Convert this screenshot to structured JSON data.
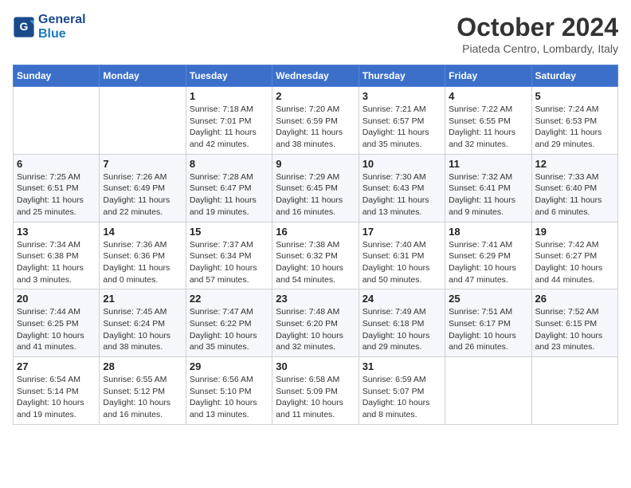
{
  "header": {
    "logo_line1": "General",
    "logo_line2": "Blue",
    "month_title": "October 2024",
    "subtitle": "Piateda Centro, Lombardy, Italy"
  },
  "days_of_week": [
    "Sunday",
    "Monday",
    "Tuesday",
    "Wednesday",
    "Thursday",
    "Friday",
    "Saturday"
  ],
  "weeks": [
    [
      {
        "day": "",
        "info": ""
      },
      {
        "day": "",
        "info": ""
      },
      {
        "day": "1",
        "info": "Sunrise: 7:18 AM\nSunset: 7:01 PM\nDaylight: 11 hours and 42 minutes."
      },
      {
        "day": "2",
        "info": "Sunrise: 7:20 AM\nSunset: 6:59 PM\nDaylight: 11 hours and 38 minutes."
      },
      {
        "day": "3",
        "info": "Sunrise: 7:21 AM\nSunset: 6:57 PM\nDaylight: 11 hours and 35 minutes."
      },
      {
        "day": "4",
        "info": "Sunrise: 7:22 AM\nSunset: 6:55 PM\nDaylight: 11 hours and 32 minutes."
      },
      {
        "day": "5",
        "info": "Sunrise: 7:24 AM\nSunset: 6:53 PM\nDaylight: 11 hours and 29 minutes."
      }
    ],
    [
      {
        "day": "6",
        "info": "Sunrise: 7:25 AM\nSunset: 6:51 PM\nDaylight: 11 hours and 25 minutes."
      },
      {
        "day": "7",
        "info": "Sunrise: 7:26 AM\nSunset: 6:49 PM\nDaylight: 11 hours and 22 minutes."
      },
      {
        "day": "8",
        "info": "Sunrise: 7:28 AM\nSunset: 6:47 PM\nDaylight: 11 hours and 19 minutes."
      },
      {
        "day": "9",
        "info": "Sunrise: 7:29 AM\nSunset: 6:45 PM\nDaylight: 11 hours and 16 minutes."
      },
      {
        "day": "10",
        "info": "Sunrise: 7:30 AM\nSunset: 6:43 PM\nDaylight: 11 hours and 13 minutes."
      },
      {
        "day": "11",
        "info": "Sunrise: 7:32 AM\nSunset: 6:41 PM\nDaylight: 11 hours and 9 minutes."
      },
      {
        "day": "12",
        "info": "Sunrise: 7:33 AM\nSunset: 6:40 PM\nDaylight: 11 hours and 6 minutes."
      }
    ],
    [
      {
        "day": "13",
        "info": "Sunrise: 7:34 AM\nSunset: 6:38 PM\nDaylight: 11 hours and 3 minutes."
      },
      {
        "day": "14",
        "info": "Sunrise: 7:36 AM\nSunset: 6:36 PM\nDaylight: 11 hours and 0 minutes."
      },
      {
        "day": "15",
        "info": "Sunrise: 7:37 AM\nSunset: 6:34 PM\nDaylight: 10 hours and 57 minutes."
      },
      {
        "day": "16",
        "info": "Sunrise: 7:38 AM\nSunset: 6:32 PM\nDaylight: 10 hours and 54 minutes."
      },
      {
        "day": "17",
        "info": "Sunrise: 7:40 AM\nSunset: 6:31 PM\nDaylight: 10 hours and 50 minutes."
      },
      {
        "day": "18",
        "info": "Sunrise: 7:41 AM\nSunset: 6:29 PM\nDaylight: 10 hours and 47 minutes."
      },
      {
        "day": "19",
        "info": "Sunrise: 7:42 AM\nSunset: 6:27 PM\nDaylight: 10 hours and 44 minutes."
      }
    ],
    [
      {
        "day": "20",
        "info": "Sunrise: 7:44 AM\nSunset: 6:25 PM\nDaylight: 10 hours and 41 minutes."
      },
      {
        "day": "21",
        "info": "Sunrise: 7:45 AM\nSunset: 6:24 PM\nDaylight: 10 hours and 38 minutes."
      },
      {
        "day": "22",
        "info": "Sunrise: 7:47 AM\nSunset: 6:22 PM\nDaylight: 10 hours and 35 minutes."
      },
      {
        "day": "23",
        "info": "Sunrise: 7:48 AM\nSunset: 6:20 PM\nDaylight: 10 hours and 32 minutes."
      },
      {
        "day": "24",
        "info": "Sunrise: 7:49 AM\nSunset: 6:18 PM\nDaylight: 10 hours and 29 minutes."
      },
      {
        "day": "25",
        "info": "Sunrise: 7:51 AM\nSunset: 6:17 PM\nDaylight: 10 hours and 26 minutes."
      },
      {
        "day": "26",
        "info": "Sunrise: 7:52 AM\nSunset: 6:15 PM\nDaylight: 10 hours and 23 minutes."
      }
    ],
    [
      {
        "day": "27",
        "info": "Sunrise: 6:54 AM\nSunset: 5:14 PM\nDaylight: 10 hours and 19 minutes."
      },
      {
        "day": "28",
        "info": "Sunrise: 6:55 AM\nSunset: 5:12 PM\nDaylight: 10 hours and 16 minutes."
      },
      {
        "day": "29",
        "info": "Sunrise: 6:56 AM\nSunset: 5:10 PM\nDaylight: 10 hours and 13 minutes."
      },
      {
        "day": "30",
        "info": "Sunrise: 6:58 AM\nSunset: 5:09 PM\nDaylight: 10 hours and 11 minutes."
      },
      {
        "day": "31",
        "info": "Sunrise: 6:59 AM\nSunset: 5:07 PM\nDaylight: 10 hours and 8 minutes."
      },
      {
        "day": "",
        "info": ""
      },
      {
        "day": "",
        "info": ""
      }
    ]
  ]
}
